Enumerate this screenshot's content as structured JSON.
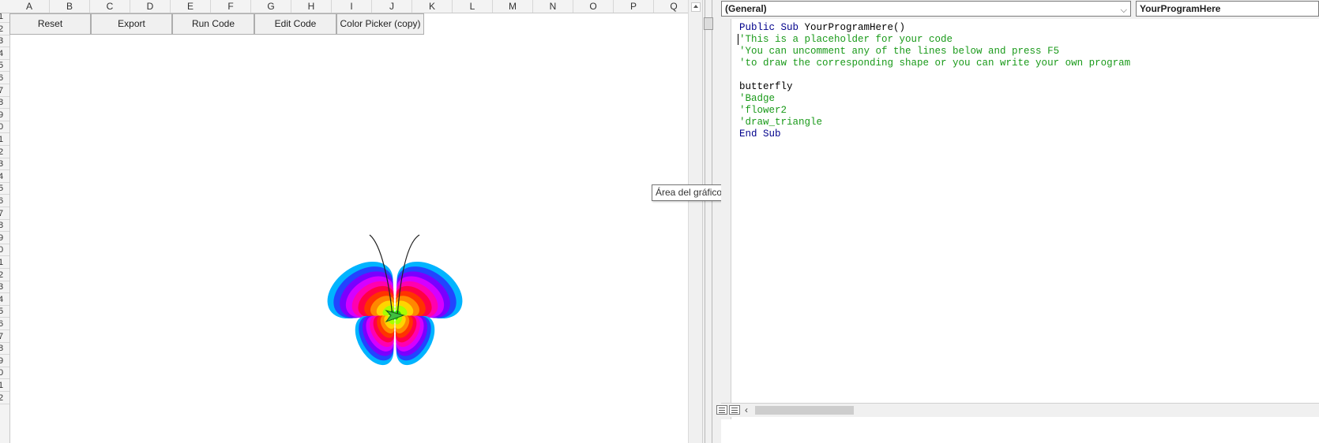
{
  "sheet": {
    "columns": [
      "A",
      "B",
      "C",
      "D",
      "E",
      "F",
      "G",
      "H",
      "I",
      "J",
      "K",
      "L",
      "M",
      "N",
      "O",
      "P",
      "Q"
    ],
    "rows": [
      "1",
      "2",
      "3",
      "4",
      "5",
      "6",
      "7",
      "8",
      "9",
      "0",
      "1",
      "2",
      "3",
      "4",
      "5",
      "6",
      "7",
      "8",
      "9",
      "0",
      "1",
      "2",
      "3",
      "4",
      "5",
      "6",
      "7",
      "8",
      "9",
      "0",
      "1",
      "2"
    ],
    "buttons": {
      "reset": "Reset",
      "export": "Export",
      "run_code": "Run Code",
      "edit_code": "Edit Code",
      "color_picker": "Color Picker (copy)"
    },
    "butterfly_colors": [
      "#00b4ff",
      "#2244ff",
      "#7a00ff",
      "#d600ff",
      "#ff00b0",
      "#ff0044",
      "#ff3300",
      "#ff8800",
      "#ffd400",
      "#a8ff00",
      "#22dd00"
    ]
  },
  "tooltip": "Área del gráfico",
  "editor": {
    "object_combo": "(General)",
    "procedure_combo": "YourProgramHere",
    "code_lines": [
      {
        "t": "Public Sub YourProgramHere()",
        "c": "mixed"
      },
      {
        "t": "'This is a placeholder for your code",
        "c": "comment"
      },
      {
        "t": "'You can uncomment any of the lines below and press F5",
        "c": "comment"
      },
      {
        "t": "'to draw the corresponding shape or you can write your own program",
        "c": "comment"
      },
      {
        "t": "",
        "c": "text"
      },
      {
        "t": "butterfly",
        "c": "text"
      },
      {
        "t": "'Badge",
        "c": "comment"
      },
      {
        "t": "'flower2",
        "c": "comment"
      },
      {
        "t": "'draw_triangle",
        "c": "comment"
      },
      {
        "t": "End Sub",
        "c": "keyword"
      }
    ],
    "colors": {
      "keyword": "#00008b",
      "comment": "#1a9a1a",
      "text": "#000000"
    }
  }
}
